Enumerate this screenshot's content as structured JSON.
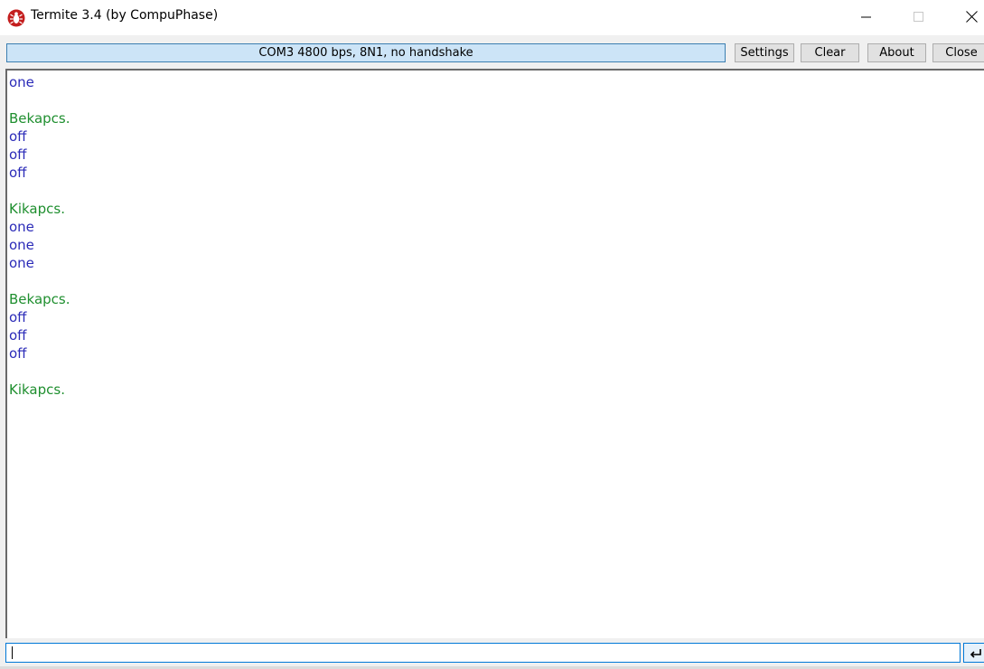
{
  "window": {
    "title": "Termite 3.4 (by CompuPhase)"
  },
  "toolbar": {
    "status": "COM3 4800 bps, 8N1, no handshake",
    "settings_label": "Settings",
    "clear_label": "Clear",
    "about_label": "About",
    "close_label": "Close"
  },
  "terminal": {
    "lines": [
      {
        "text": "one",
        "kind": "rx"
      },
      {
        "text": "",
        "kind": "rx"
      },
      {
        "text": "Bekapcs.",
        "kind": "tx"
      },
      {
        "text": "off",
        "kind": "rx"
      },
      {
        "text": "off",
        "kind": "rx"
      },
      {
        "text": "off",
        "kind": "rx"
      },
      {
        "text": "",
        "kind": "rx"
      },
      {
        "text": "Kikapcs.",
        "kind": "tx"
      },
      {
        "text": "one",
        "kind": "rx"
      },
      {
        "text": "one",
        "kind": "rx"
      },
      {
        "text": "one",
        "kind": "rx"
      },
      {
        "text": "",
        "kind": "rx"
      },
      {
        "text": "Bekapcs.",
        "kind": "tx"
      },
      {
        "text": "off",
        "kind": "rx"
      },
      {
        "text": "off",
        "kind": "rx"
      },
      {
        "text": "off",
        "kind": "rx"
      },
      {
        "text": "",
        "kind": "rx"
      },
      {
        "text": "Kikapcs.",
        "kind": "tx"
      }
    ],
    "colors": {
      "received": "#2b2bb8",
      "sent": "#1f8f2f"
    }
  },
  "input": {
    "value": ""
  },
  "icons": {
    "app": "termite-bug-icon",
    "minimize": "minimize-icon",
    "maximize": "maximize-icon",
    "close": "close-icon",
    "send": "enter-arrow-icon"
  }
}
